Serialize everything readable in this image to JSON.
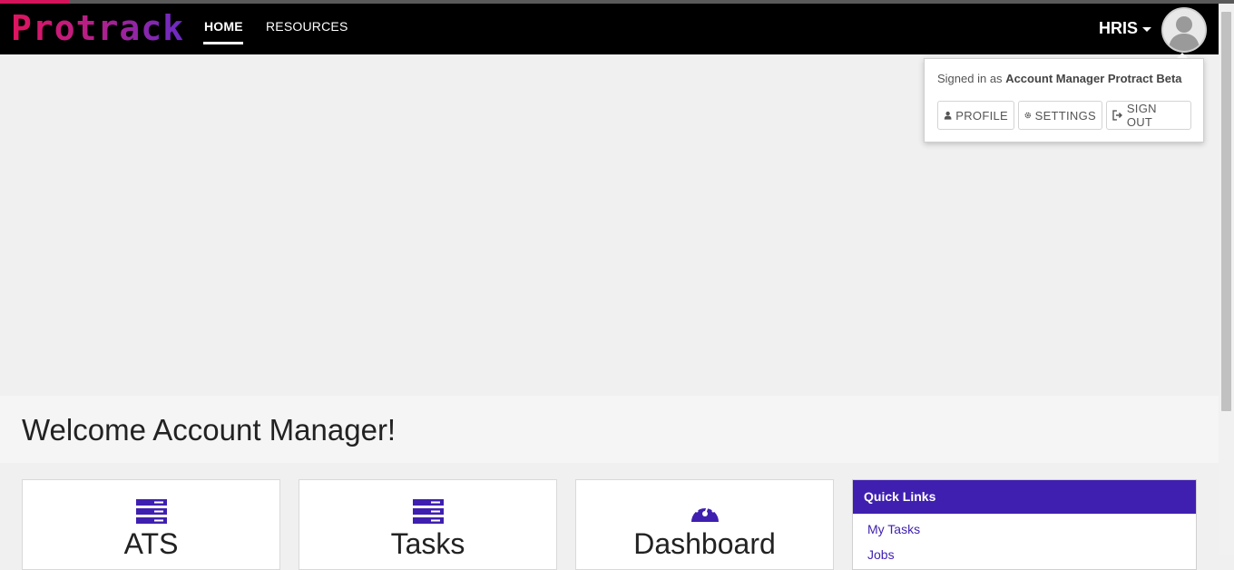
{
  "brand": {
    "logo_text": "Protrack",
    "accent": "#3f1fb0",
    "pink": "#d4145a"
  },
  "nav": {
    "home_label": "HOME",
    "resources_label": "RESOURCES",
    "user_menu_label": "HRIS"
  },
  "account_popover": {
    "signed_in_prefix": "Signed in as",
    "signed_in_name": "Account Manager Protract Beta",
    "profile_label": "PROFILE",
    "settings_label": "SETTINGS",
    "signout_label": "SIGN OUT"
  },
  "welcome": {
    "title": "Welcome Account Manager!"
  },
  "tiles": [
    {
      "label": "ATS",
      "icon": "server-icon"
    },
    {
      "label": "Tasks",
      "icon": "server-icon"
    },
    {
      "label": "Dashboard",
      "icon": "speedometer-icon"
    }
  ],
  "quick_links": {
    "title": "Quick Links",
    "items": [
      "My Tasks",
      "Jobs"
    ]
  }
}
